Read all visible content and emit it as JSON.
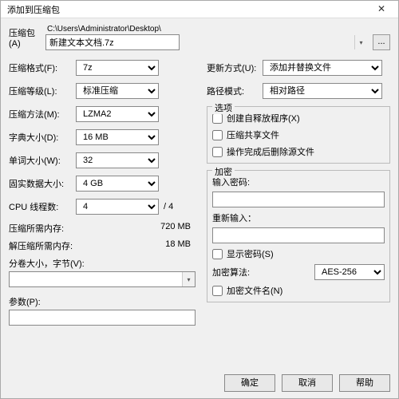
{
  "window": {
    "title": "添加到压缩包"
  },
  "archive": {
    "label": "压缩包(A)",
    "path_prefix": "C:\\Users\\Administrator\\Desktop\\",
    "filename": "新建文本文档.7z",
    "browse": "..."
  },
  "left": {
    "format": {
      "label": "压缩格式(F):",
      "value": "7z"
    },
    "level": {
      "label": "压缩等级(L):",
      "value": "标准压缩"
    },
    "method": {
      "label": "压缩方法(M):",
      "value": "LZMA2"
    },
    "dict": {
      "label": "字典大小(D):",
      "value": "16 MB"
    },
    "word": {
      "label": "单词大小(W):",
      "value": "32"
    },
    "solid": {
      "label": "固实数据大小:",
      "value": "4 GB"
    },
    "cpu": {
      "label": "CPU 线程数:",
      "value": "4",
      "total": "/ 4"
    },
    "mem_compress": {
      "label": "压缩所需内存:",
      "value": "720 MB"
    },
    "mem_decompress": {
      "label": "解压缩所需内存:",
      "value": "18 MB"
    },
    "split": {
      "label": "分卷大小，字节(V):"
    },
    "params": {
      "label": "参数(P):"
    }
  },
  "right": {
    "update": {
      "label": "更新方式(U):",
      "value": "添加并替换文件"
    },
    "pathmode": {
      "label": "路径模式:",
      "value": "相对路径"
    },
    "options": {
      "legend": "选项",
      "sfx": "创建自释放程序(X)",
      "shared": "压缩共享文件",
      "delete_after": "操作完成后删除源文件"
    },
    "encryption": {
      "legend": "加密",
      "pwd_label": "输入密码:",
      "pwd2_label": "重新输入：",
      "show_pwd": "显示密码(S)",
      "algo_label": "加密算法:",
      "algo_value": "AES-256",
      "encrypt_names": "加密文件名(N)"
    }
  },
  "buttons": {
    "ok": "确定",
    "cancel": "取消",
    "help": "帮助"
  }
}
